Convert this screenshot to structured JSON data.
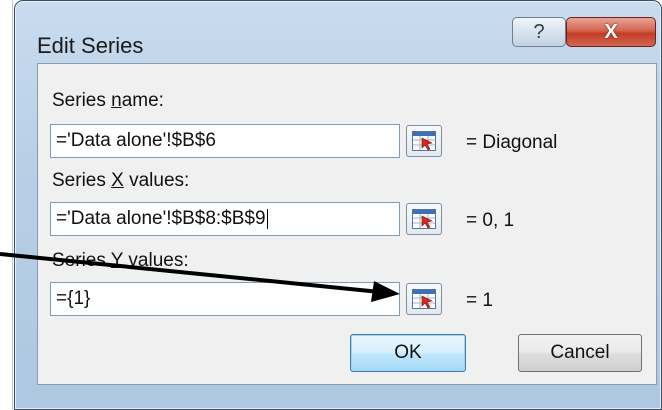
{
  "dialog": {
    "title": "Edit Series",
    "help_symbol": "?",
    "close_symbol": "X"
  },
  "series_name": {
    "label_pre": "Series ",
    "label_accel": "n",
    "label_post": "ame:",
    "value": "='Data alone'!$B$6",
    "result": "= Diagonal"
  },
  "series_x": {
    "label_pre": "Series ",
    "label_accel": "X",
    "label_post": " values:",
    "value": "='Data alone'!$B$8:$B$9",
    "result": "= 0, 1"
  },
  "series_y": {
    "label_pre": "Series ",
    "label_accel": "Y",
    "label_post": " values:",
    "value": "={1}",
    "result": "= 1"
  },
  "buttons": {
    "ok": "OK",
    "cancel": "Cancel"
  },
  "icons": {
    "help": "help-icon",
    "close": "close-icon",
    "range_selector": "range-selector-icon"
  },
  "colors": {
    "frame": "#b8cfe6",
    "close_button": "#c23d26",
    "default_button": "#bee6fd",
    "annotation_arrow": "#000000"
  }
}
